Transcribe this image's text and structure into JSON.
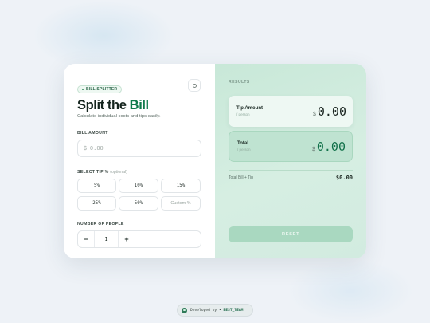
{
  "app": {
    "badge": "BILL SPLITTER",
    "title_part1": "Split the ",
    "title_part2": "Bill",
    "subtitle": "Calculate individual costs and tips easily."
  },
  "bill": {
    "label": "BILL AMOUNT",
    "currency": "$",
    "placeholder": "0.00"
  },
  "tip": {
    "label": "SELECT TIP %",
    "optional": "(optional)",
    "options": [
      "5%",
      "10%",
      "15%",
      "25%",
      "50%"
    ],
    "custom_placeholder": "Custom %"
  },
  "people": {
    "label": "NUMBER OF PEOPLE",
    "decrement": "−",
    "value": "1",
    "increment": "+"
  },
  "results": {
    "label": "RESULTS",
    "tip_amount": {
      "name": "Tip Amount",
      "sub": "/ person",
      "currency": "$",
      "value": "0.00"
    },
    "total": {
      "name": "Total",
      "sub": "/ person",
      "currency": "$",
      "value": "0.00"
    },
    "summary_label": "Total Bill + Tip",
    "summary_value": "$0.00",
    "reset_label": "RESET"
  },
  "footer": {
    "prefix": "Developed by •",
    "team": "BEST_TEAM"
  },
  "colors": {
    "accent": "#0f7a4b",
    "results_panel": "#d0ecdf",
    "reset_button": "#a9d8c0"
  },
  "icons": {
    "theme_toggle": "sun-icon",
    "footer_logo": "circle-logo-icon"
  }
}
